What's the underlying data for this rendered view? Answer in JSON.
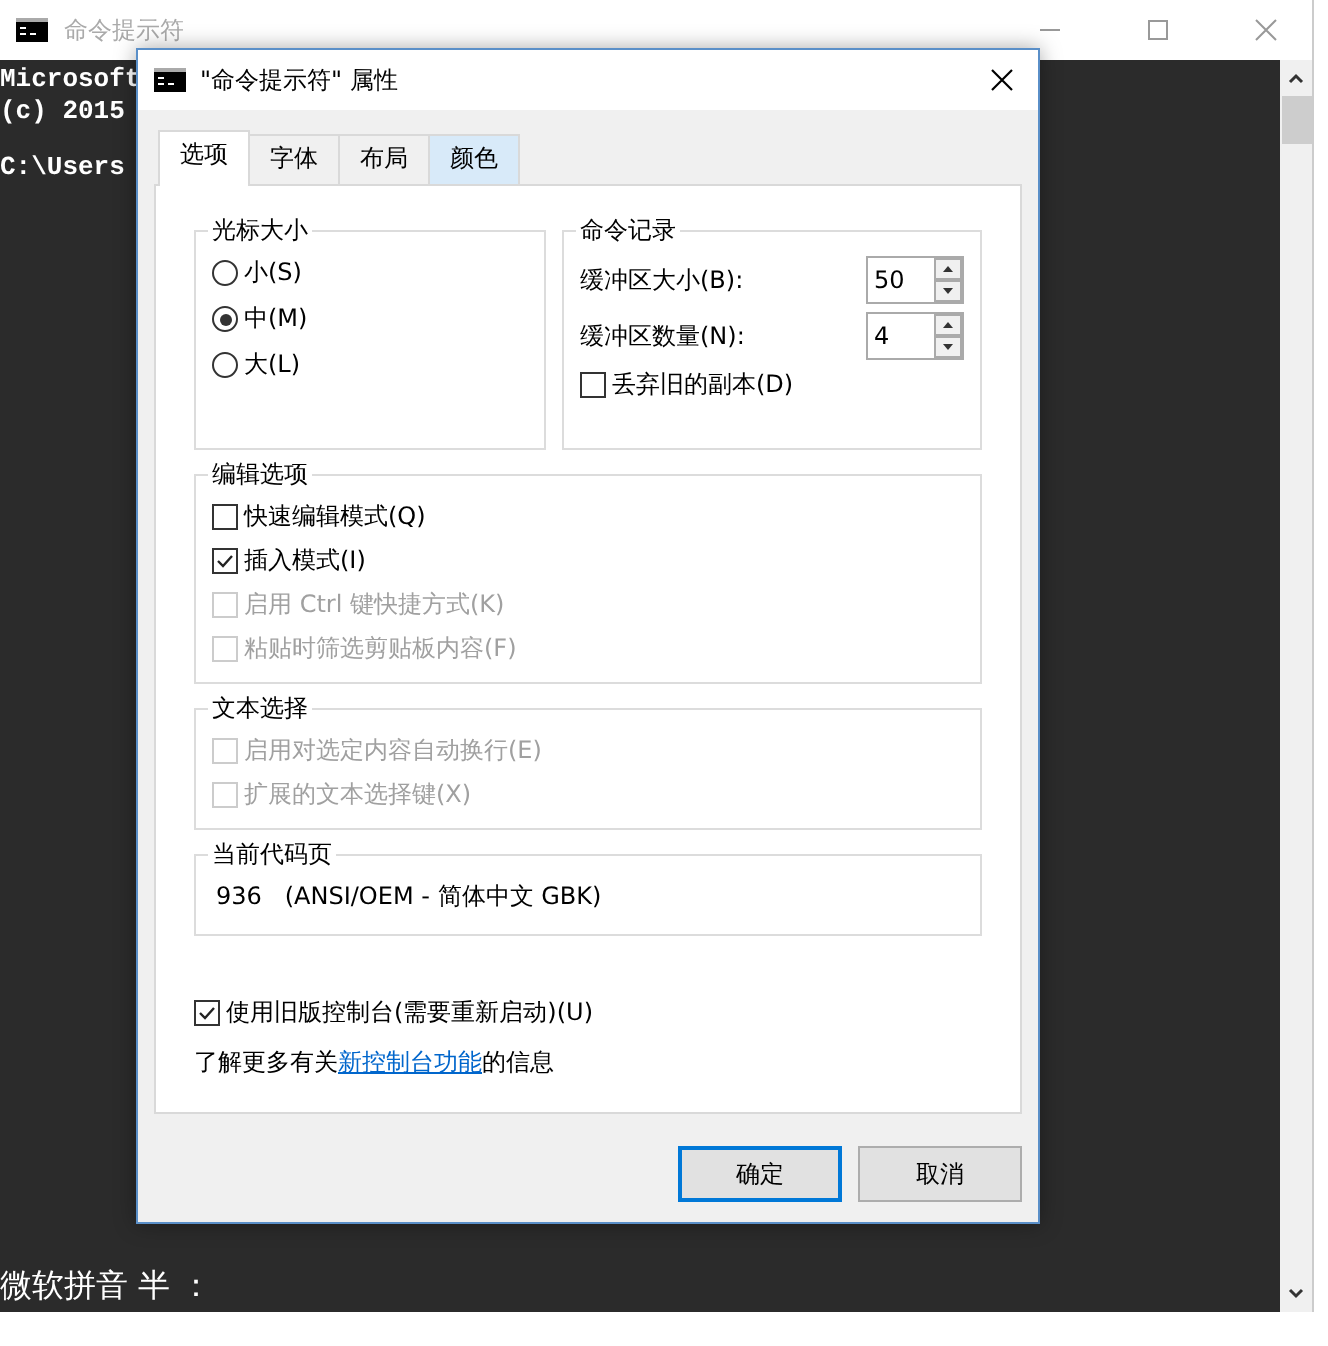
{
  "console": {
    "title": "命令提示符",
    "lines": [
      "Microsoft",
      "(c) 2015",
      "C:\\Users"
    ],
    "ime_status": "微软拼音 半 ："
  },
  "dialog": {
    "title": "\"命令提示符\" 属性",
    "tabs": [
      {
        "label": "选项",
        "selected": true,
        "hover": false
      },
      {
        "label": "字体",
        "selected": false,
        "hover": false
      },
      {
        "label": "布局",
        "selected": false,
        "hover": false
      },
      {
        "label": "颜色",
        "selected": false,
        "hover": true
      }
    ],
    "cursor_size": {
      "title": "光标大小",
      "options": [
        {
          "label": "小(S)",
          "selected": false
        },
        {
          "label": "中(M)",
          "selected": true
        },
        {
          "label": "大(L)",
          "selected": false
        }
      ]
    },
    "command_history": {
      "title": "命令记录",
      "fields": [
        {
          "label": "缓冲区大小(B):",
          "value": "50"
        },
        {
          "label": "缓冲区数量(N):",
          "value": "4"
        }
      ],
      "discard": {
        "label": "丢弃旧的副本(D)",
        "checked": false
      }
    },
    "edit_options": {
      "title": "编辑选项",
      "items": [
        {
          "label": "快速编辑模式(Q)",
          "checked": false,
          "disabled": false
        },
        {
          "label": "插入模式(I)",
          "checked": true,
          "disabled": false
        },
        {
          "label": "启用 Ctrl 键快捷方式(K)",
          "checked": false,
          "disabled": true
        },
        {
          "label": "粘贴时筛选剪贴板内容(F)",
          "checked": false,
          "disabled": true
        }
      ]
    },
    "text_selection": {
      "title": "文本选择",
      "items": [
        {
          "label": "启用对选定内容自动换行(E)",
          "checked": false,
          "disabled": true
        },
        {
          "label": "扩展的文本选择键(X)",
          "checked": false,
          "disabled": true
        }
      ]
    },
    "code_page": {
      "title": "当前代码页",
      "value": "936   (ANSI/OEM - 简体中文 GBK)"
    },
    "legacy": {
      "label": "使用旧版控制台(需要重新启动)(U)",
      "checked": true
    },
    "info": {
      "before": "了解更多有关",
      "link": "新控制台功能",
      "after": "的信息"
    },
    "buttons": [
      {
        "label": "确定",
        "default": true
      },
      {
        "label": "取消",
        "default": false
      }
    ]
  }
}
